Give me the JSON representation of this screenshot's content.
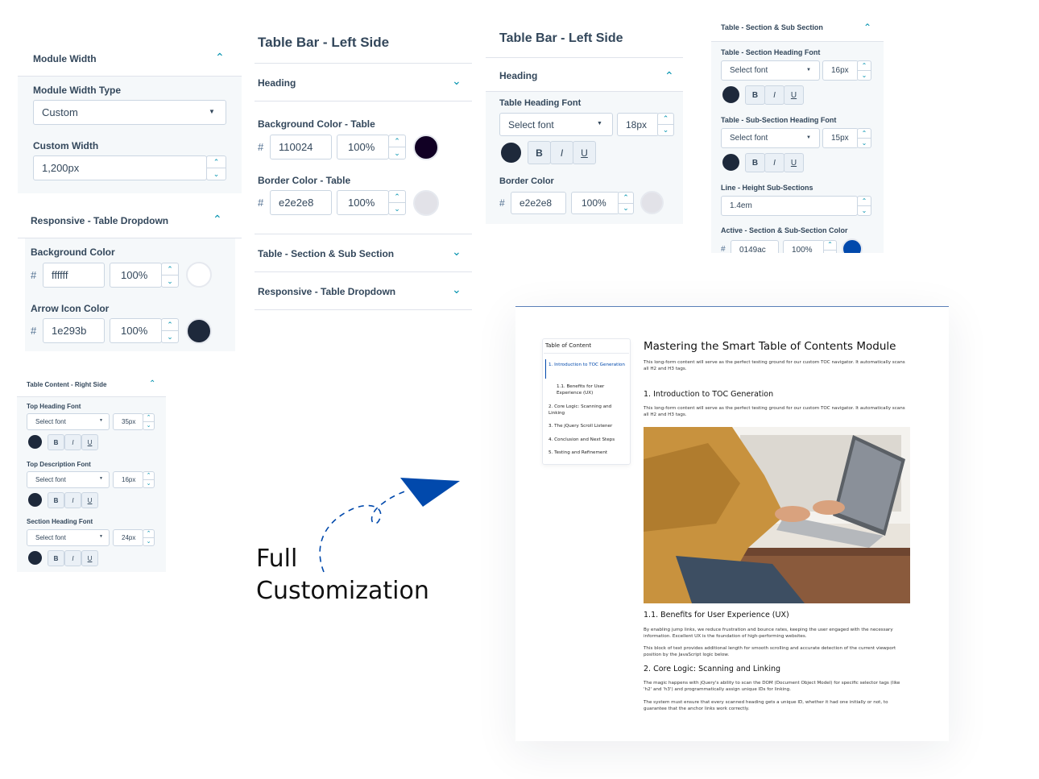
{
  "panel_module": {
    "module_width_title": "Module Width",
    "width_type_label": "Module Width Type",
    "width_type_value": "Custom",
    "custom_width_label": "Custom Width",
    "custom_width_value": "1,200px",
    "responsive_title": "Responsive - Table Dropdown",
    "bg_color_label": "Background Color",
    "bg_hex": "ffffff",
    "bg_opacity": "100%",
    "arrow_label": "Arrow Icon Color",
    "arrow_hex": "1e293b",
    "arrow_opacity": "100%",
    "colors": {
      "bg_swatch": "#ffffff",
      "arrow_swatch": "#1e293b"
    }
  },
  "panel_left_side": {
    "title": "Table Bar - Left Side",
    "heading_section": "Heading",
    "bg_table_label": "Background Color - Table",
    "bg_table_hex": "110024",
    "bg_table_opacity": "100%",
    "border_table_label": "Border Color - Table",
    "border_table_hex": "e2e2e8",
    "border_table_opacity": "100%",
    "section_sub": "Table - Section & Sub Section",
    "responsive": "Responsive - Table Dropdown",
    "colors": {
      "bg_swatch": "#110024",
      "border_swatch": "#e2e2e8"
    }
  },
  "panel_heading": {
    "title": "Table Bar - Left Side",
    "heading_section": "Heading",
    "heading_font_label": "Table Heading Font",
    "font_select": "Select font",
    "font_size": "18px",
    "border_color_label": "Border Color",
    "border_hex": "e2e2e8",
    "border_opacity": "100%",
    "bold": "B",
    "italic": "I",
    "underline": "U"
  },
  "panel_section": {
    "title": "Table - Section & Sub Section",
    "section_font_label": "Table - Section Heading Font",
    "section_font_select": "Select font",
    "section_font_size": "16px",
    "sub_font_label": "Table - Sub-Section Heading Font",
    "sub_font_select": "Select font",
    "sub_font_size": "15px",
    "line_height_label": "Line - Height Sub-Sections",
    "line_height_value": "1.4em",
    "active_label": "Active - Section & Sub-Section Color",
    "active_hex": "0149ac",
    "active_opacity": "100%",
    "bold": "B",
    "italic": "I",
    "underline": "U",
    "colors": {
      "active_swatch": "#0149ac"
    }
  },
  "panel_right": {
    "title": "Table Content - Right Side",
    "top_heading_label": "Top Heading Font",
    "top_heading_select": "Select font",
    "top_heading_size": "35px",
    "top_desc_label": "Top Description Font",
    "top_desc_select": "Select font",
    "top_desc_size": "16px",
    "section_heading_label": "Section Heading Font",
    "section_heading_select": "Select font",
    "section_heading_size": "24px",
    "bold": "B",
    "italic": "I",
    "underline": "U"
  },
  "tagline": {
    "line1": "Full",
    "line2": "Customization"
  },
  "preview": {
    "toc_title": "Table of Content",
    "toc_items": [
      "1. Introduction to TOC Generation",
      "1.1. Benefits for User Experience (UX)",
      "2. Core Logic: Scanning and Linking",
      "3. The jQuery Scroll Listener",
      "4. Conclusion and Next Steps",
      "5. Testing and Refinement"
    ],
    "title": "Mastering the Smart Table of Contents Module",
    "intro": "This long-form content will serve as the perfect testing ground for our custom TOC navigator. It automatically scans all H2 and H3 tags.",
    "h1": "1. Introduction to TOC Generation",
    "p1": "This long-form content will serve as the perfect testing ground for our custom TOC navigator. It automatically scans all H2 and H3 tags.",
    "h2": "1.1. Benefits for User Experience (UX)",
    "p2": "By enabling jump links, we reduce frustration and bounce rates, keeping the user engaged with the necessary information. Excellent UX is the foundation of high-performing websites.",
    "p3": "This block of text provides additional length for smooth scrolling and accurate detection of the current viewport position by the JavaScript logic below.",
    "h3": "2. Core Logic: Scanning and Linking",
    "p4": "The magic happens with jQuery's ability to scan the DOM (Document Object Model) for specific selector tags (like 'h2' and 'h3') and programmatically assign unique IDs for linking.",
    "p5": "The system must ensure that every scanned heading gets a unique ID, whether it had one initially or not, to guarantee that the anchor links work correctly.",
    "accent_color": "#0149ac"
  }
}
